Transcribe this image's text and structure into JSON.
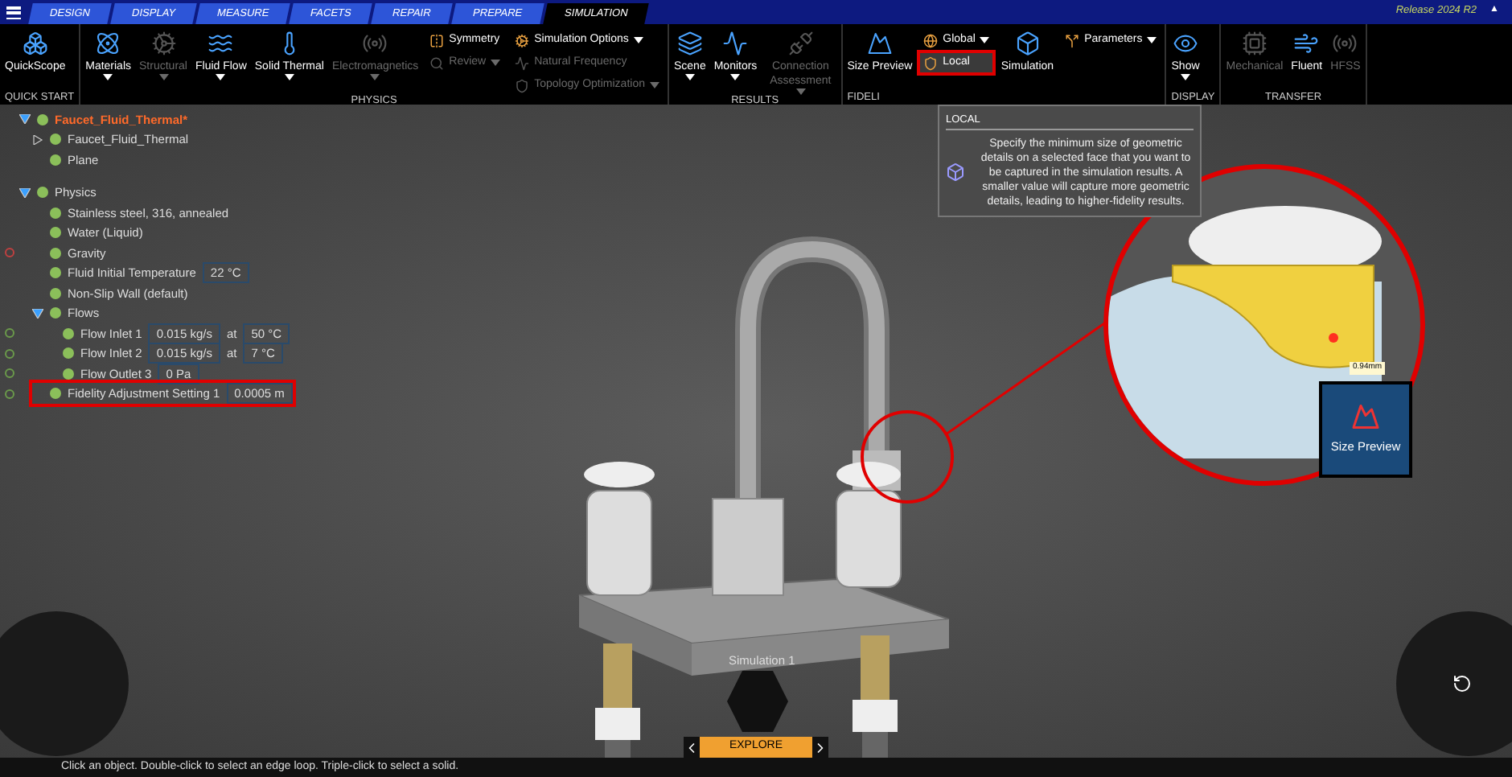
{
  "window": {
    "release": "Release 2024 R2",
    "collapse_glyph": "▲"
  },
  "tabs": [
    {
      "label": "DESIGN",
      "selected": false
    },
    {
      "label": "DISPLAY",
      "selected": false
    },
    {
      "label": "MEASURE",
      "selected": false
    },
    {
      "label": "FACETS",
      "selected": false
    },
    {
      "label": "REPAIR",
      "selected": false
    },
    {
      "label": "PREPARE",
      "selected": false
    },
    {
      "label": "SIMULATION",
      "selected": true
    }
  ],
  "ribbon": {
    "groups": [
      {
        "label": "QUICK START",
        "buttons": [
          {
            "kind": "large",
            "label": "QuickScope",
            "disabled": false,
            "dropdown": false
          }
        ]
      },
      {
        "label": "PHYSICS",
        "buttons": [
          {
            "kind": "large",
            "label": "Materials",
            "disabled": false,
            "dropdown": true
          },
          {
            "kind": "large",
            "label": "Structural",
            "disabled": true,
            "dropdown": true
          },
          {
            "kind": "large",
            "label": "Fluid Flow",
            "disabled": false,
            "dropdown": true
          },
          {
            "kind": "large",
            "label": "Solid Thermal",
            "disabled": false,
            "dropdown": true
          },
          {
            "kind": "large",
            "label": "Electromagnetics",
            "disabled": true,
            "dropdown": true
          },
          {
            "kind": "stack",
            "items": [
              {
                "label": "Symmetry",
                "disabled": false,
                "dropdown": false
              },
              {
                "label": "Review",
                "disabled": true,
                "dropdown": true
              }
            ]
          },
          {
            "kind": "stack",
            "items": [
              {
                "label": "Simulation Options",
                "disabled": false,
                "dropdown": true
              },
              {
                "label": "Natural Frequency",
                "disabled": true,
                "dropdown": false
              },
              {
                "label": "Topology Optimization",
                "disabled": true,
                "dropdown": true
              }
            ]
          }
        ]
      },
      {
        "label": "RESULTS",
        "buttons": [
          {
            "kind": "large",
            "label": "Scene",
            "disabled": false,
            "dropdown": true
          },
          {
            "kind": "large",
            "label": "Monitors",
            "disabled": false,
            "dropdown": true
          },
          {
            "kind": "large",
            "label": "Connection Assessment",
            "disabled": true,
            "dropdown": true
          }
        ]
      },
      {
        "label": "FIDELI",
        "buttons": [
          {
            "kind": "large",
            "label": "Size Preview",
            "disabled": false,
            "dropdown": false
          },
          {
            "kind": "stack",
            "items": [
              {
                "label": "Global",
                "disabled": false,
                "dropdown": true,
                "highlighted": false
              },
              {
                "label": "Local",
                "disabled": false,
                "dropdown": false,
                "highlighted": true
              }
            ]
          },
          {
            "kind": "large",
            "label": "Simulation",
            "disabled": false,
            "dropdown": false
          },
          {
            "kind": "stack",
            "items": [
              {
                "label": "Parameters",
                "disabled": false,
                "dropdown": true
              }
            ]
          }
        ]
      },
      {
        "label": "DISPLAY",
        "buttons": [
          {
            "kind": "large",
            "label": "Show",
            "disabled": false,
            "dropdown": true
          }
        ]
      },
      {
        "label": "TRANSFER",
        "buttons": [
          {
            "kind": "large",
            "label": "Mechanical",
            "disabled": true,
            "dropdown": false
          },
          {
            "kind": "large",
            "label": "Fluent",
            "disabled": false,
            "dropdown": false
          },
          {
            "kind": "large",
            "label": "HFSS",
            "disabled": true,
            "dropdown": false
          }
        ]
      }
    ]
  },
  "tooltip": {
    "title": "LOCAL",
    "text": "Specify the minimum size of geometric details on a selected face that you want to be captured in the simulation results. A smaller value will capture more geometric details, leading to higher-fidelity results."
  },
  "tree": [
    {
      "label": "Faucet_Fluid_Thermal*",
      "kind": "root",
      "expanded": true,
      "children": [
        {
          "label": "Faucet_Fluid_Thermal",
          "expanded": false
        },
        {
          "label": "Plane"
        }
      ]
    },
    {
      "label": "Physics",
      "expanded": true,
      "children": [
        {
          "label": "Stainless steel, 316, annealed"
        },
        {
          "label": "Water (Liquid)"
        },
        {
          "label": "Gravity",
          "color": "#c04040"
        },
        {
          "label": "Fluid Initial Temperature",
          "values": [
            "22 °C"
          ]
        },
        {
          "label": "Non-Slip Wall (default)"
        },
        {
          "label": "Flows",
          "expanded": true,
          "children": [
            {
              "label": "Flow Inlet 1",
              "values": [
                "0.015 kg/s",
                "50 °C"
              ],
              "joiner": "at",
              "color": "#6a9a4a"
            },
            {
              "label": "Flow Inlet 2",
              "values": [
                "0.015 kg/s",
                "7 °C"
              ],
              "joiner": "at",
              "color": "#6a9a4a"
            },
            {
              "label": "Flow Outlet 3",
              "values": [
                "0 Pa"
              ],
              "color": "#6a9a4a"
            }
          ]
        },
        {
          "label": "Fidelity Adjustment Setting 1",
          "values": [
            "0.0005 m"
          ],
          "highlighted": true,
          "color": "#6a9a4a"
        }
      ]
    }
  ],
  "viewport": {
    "measure_label": "0.94mm",
    "zoom_badge": "Size Preview",
    "simulation_label": "Simulation 1",
    "mode_tab": "EXPLORE"
  },
  "status_bar": {
    "message": "Click an object. Double-click to select an edge loop. Triple-click to select a solid."
  }
}
